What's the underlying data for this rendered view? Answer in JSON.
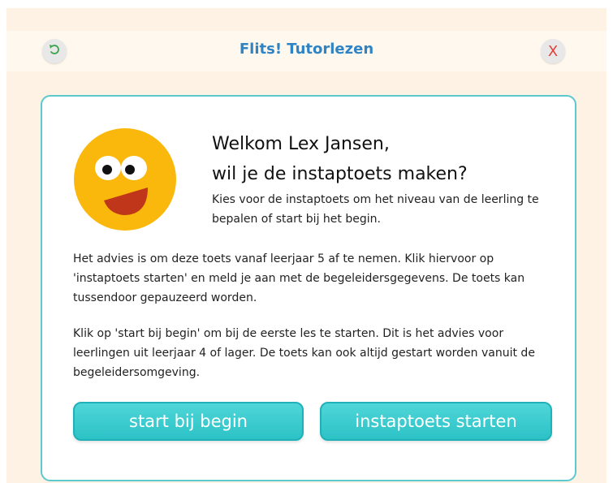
{
  "header": {
    "title": "Flits! Tutorlezen",
    "back_icon": "undo-arrow-icon",
    "close_label": "X"
  },
  "welcome": {
    "title_line1": "Welkom Lex Jansen,",
    "title_line2": "wil je de instaptoets maken?",
    "subtitle": "Kies voor de instaptoets om het niveau van de leerling te bepalen of start bij het begin."
  },
  "body": {
    "paragraph1": "Het advies is om deze toets vanaf leerjaar 5 af te nemen. Klik hiervoor op 'instaptoets starten' en meld je aan met de begeleidersgegevens. De toets kan tussendoor gepauzeerd worden.",
    "paragraph2": "Klik op 'start bij begin' om bij de eerste les te starten. Dit is het advies voor leerlingen uit leerjaar 4 of lager. De toets kan ook altijd gestart worden vanuit de begeleidersomgeving."
  },
  "buttons": {
    "start_label": "start bij begin",
    "instap_label": "instaptoets starten"
  },
  "colors": {
    "background": "#fdf2e3",
    "title_blue": "#2e84c5",
    "accent_teal": "#2cc2c6",
    "close_red": "#e0423a",
    "mascot_yellow": "#f9b80b",
    "mascot_mouth": "#c0361a"
  }
}
